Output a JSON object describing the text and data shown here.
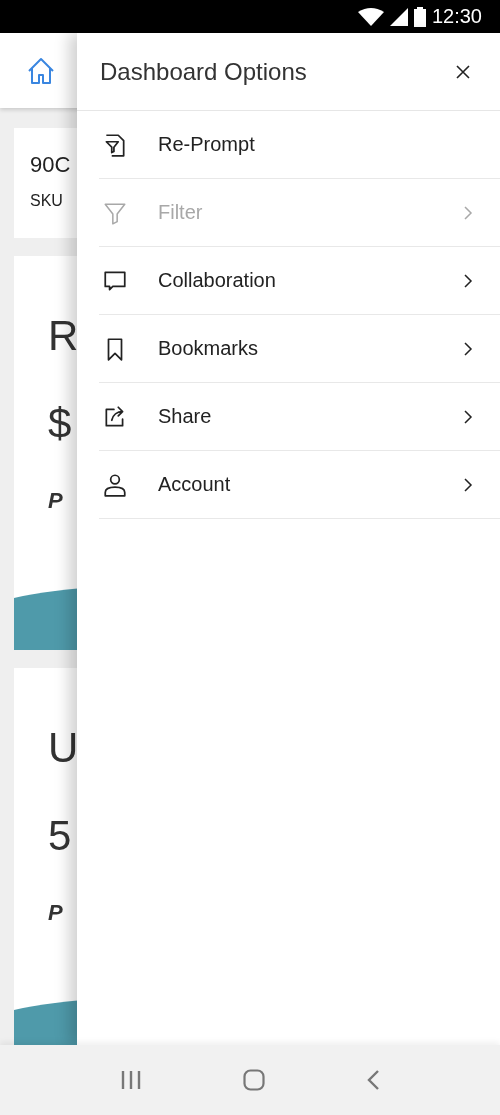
{
  "status_bar": {
    "time": "12:30"
  },
  "background": {
    "cards": [
      {
        "kind": "info",
        "title": "90C",
        "subtitle": "SKU"
      },
      {
        "kind": "metric",
        "label": "R",
        "value": "$",
        "caption": "P"
      },
      {
        "kind": "metric",
        "label": "U",
        "value": "5",
        "caption": "P"
      }
    ]
  },
  "drawer": {
    "title": "Dashboard Options",
    "items": [
      {
        "label": "Re-Prompt",
        "kind": "reprompt",
        "disabled": false,
        "has_arrow": false
      },
      {
        "label": "Filter",
        "kind": "filter",
        "disabled": true,
        "has_arrow": true
      },
      {
        "label": "Collaboration",
        "kind": "comment",
        "disabled": false,
        "has_arrow": true
      },
      {
        "label": "Bookmarks",
        "kind": "bookmark",
        "disabled": false,
        "has_arrow": true
      },
      {
        "label": "Share",
        "kind": "share",
        "disabled": false,
        "has_arrow": true
      },
      {
        "label": "Account",
        "kind": "person",
        "disabled": false,
        "has_arrow": true
      }
    ]
  }
}
